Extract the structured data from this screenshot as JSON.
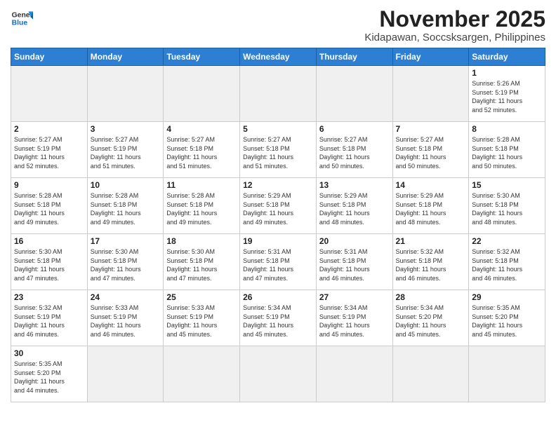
{
  "logo": {
    "line1": "General",
    "line2": "Blue"
  },
  "header": {
    "month": "November 2025",
    "location": "Kidapawan, Soccsksargen, Philippines"
  },
  "weekdays": [
    "Sunday",
    "Monday",
    "Tuesday",
    "Wednesday",
    "Thursday",
    "Friday",
    "Saturday"
  ],
  "weeks": [
    [
      {
        "day": "",
        "info": ""
      },
      {
        "day": "",
        "info": ""
      },
      {
        "day": "",
        "info": ""
      },
      {
        "day": "",
        "info": ""
      },
      {
        "day": "",
        "info": ""
      },
      {
        "day": "",
        "info": ""
      },
      {
        "day": "1",
        "info": "Sunrise: 5:26 AM\nSunset: 5:19 PM\nDaylight: 11 hours\nand 52 minutes."
      }
    ],
    [
      {
        "day": "2",
        "info": "Sunrise: 5:27 AM\nSunset: 5:19 PM\nDaylight: 11 hours\nand 52 minutes."
      },
      {
        "day": "3",
        "info": "Sunrise: 5:27 AM\nSunset: 5:19 PM\nDaylight: 11 hours\nand 51 minutes."
      },
      {
        "day": "4",
        "info": "Sunrise: 5:27 AM\nSunset: 5:18 PM\nDaylight: 11 hours\nand 51 minutes."
      },
      {
        "day": "5",
        "info": "Sunrise: 5:27 AM\nSunset: 5:18 PM\nDaylight: 11 hours\nand 51 minutes."
      },
      {
        "day": "6",
        "info": "Sunrise: 5:27 AM\nSunset: 5:18 PM\nDaylight: 11 hours\nand 50 minutes."
      },
      {
        "day": "7",
        "info": "Sunrise: 5:27 AM\nSunset: 5:18 PM\nDaylight: 11 hours\nand 50 minutes."
      },
      {
        "day": "8",
        "info": "Sunrise: 5:28 AM\nSunset: 5:18 PM\nDaylight: 11 hours\nand 50 minutes."
      }
    ],
    [
      {
        "day": "9",
        "info": "Sunrise: 5:28 AM\nSunset: 5:18 PM\nDaylight: 11 hours\nand 49 minutes."
      },
      {
        "day": "10",
        "info": "Sunrise: 5:28 AM\nSunset: 5:18 PM\nDaylight: 11 hours\nand 49 minutes."
      },
      {
        "day": "11",
        "info": "Sunrise: 5:28 AM\nSunset: 5:18 PM\nDaylight: 11 hours\nand 49 minutes."
      },
      {
        "day": "12",
        "info": "Sunrise: 5:29 AM\nSunset: 5:18 PM\nDaylight: 11 hours\nand 49 minutes."
      },
      {
        "day": "13",
        "info": "Sunrise: 5:29 AM\nSunset: 5:18 PM\nDaylight: 11 hours\nand 48 minutes."
      },
      {
        "day": "14",
        "info": "Sunrise: 5:29 AM\nSunset: 5:18 PM\nDaylight: 11 hours\nand 48 minutes."
      },
      {
        "day": "15",
        "info": "Sunrise: 5:30 AM\nSunset: 5:18 PM\nDaylight: 11 hours\nand 48 minutes."
      }
    ],
    [
      {
        "day": "16",
        "info": "Sunrise: 5:30 AM\nSunset: 5:18 PM\nDaylight: 11 hours\nand 47 minutes."
      },
      {
        "day": "17",
        "info": "Sunrise: 5:30 AM\nSunset: 5:18 PM\nDaylight: 11 hours\nand 47 minutes."
      },
      {
        "day": "18",
        "info": "Sunrise: 5:30 AM\nSunset: 5:18 PM\nDaylight: 11 hours\nand 47 minutes."
      },
      {
        "day": "19",
        "info": "Sunrise: 5:31 AM\nSunset: 5:18 PM\nDaylight: 11 hours\nand 47 minutes."
      },
      {
        "day": "20",
        "info": "Sunrise: 5:31 AM\nSunset: 5:18 PM\nDaylight: 11 hours\nand 46 minutes."
      },
      {
        "day": "21",
        "info": "Sunrise: 5:32 AM\nSunset: 5:18 PM\nDaylight: 11 hours\nand 46 minutes."
      },
      {
        "day": "22",
        "info": "Sunrise: 5:32 AM\nSunset: 5:18 PM\nDaylight: 11 hours\nand 46 minutes."
      }
    ],
    [
      {
        "day": "23",
        "info": "Sunrise: 5:32 AM\nSunset: 5:19 PM\nDaylight: 11 hours\nand 46 minutes."
      },
      {
        "day": "24",
        "info": "Sunrise: 5:33 AM\nSunset: 5:19 PM\nDaylight: 11 hours\nand 46 minutes."
      },
      {
        "day": "25",
        "info": "Sunrise: 5:33 AM\nSunset: 5:19 PM\nDaylight: 11 hours\nand 45 minutes."
      },
      {
        "day": "26",
        "info": "Sunrise: 5:34 AM\nSunset: 5:19 PM\nDaylight: 11 hours\nand 45 minutes."
      },
      {
        "day": "27",
        "info": "Sunrise: 5:34 AM\nSunset: 5:19 PM\nDaylight: 11 hours\nand 45 minutes."
      },
      {
        "day": "28",
        "info": "Sunrise: 5:34 AM\nSunset: 5:20 PM\nDaylight: 11 hours\nand 45 minutes."
      },
      {
        "day": "29",
        "info": "Sunrise: 5:35 AM\nSunset: 5:20 PM\nDaylight: 11 hours\nand 45 minutes."
      }
    ],
    [
      {
        "day": "30",
        "info": "Sunrise: 5:35 AM\nSunset: 5:20 PM\nDaylight: 11 hours\nand 44 minutes."
      },
      {
        "day": "",
        "info": ""
      },
      {
        "day": "",
        "info": ""
      },
      {
        "day": "",
        "info": ""
      },
      {
        "day": "",
        "info": ""
      },
      {
        "day": "",
        "info": ""
      },
      {
        "day": "",
        "info": ""
      }
    ]
  ]
}
